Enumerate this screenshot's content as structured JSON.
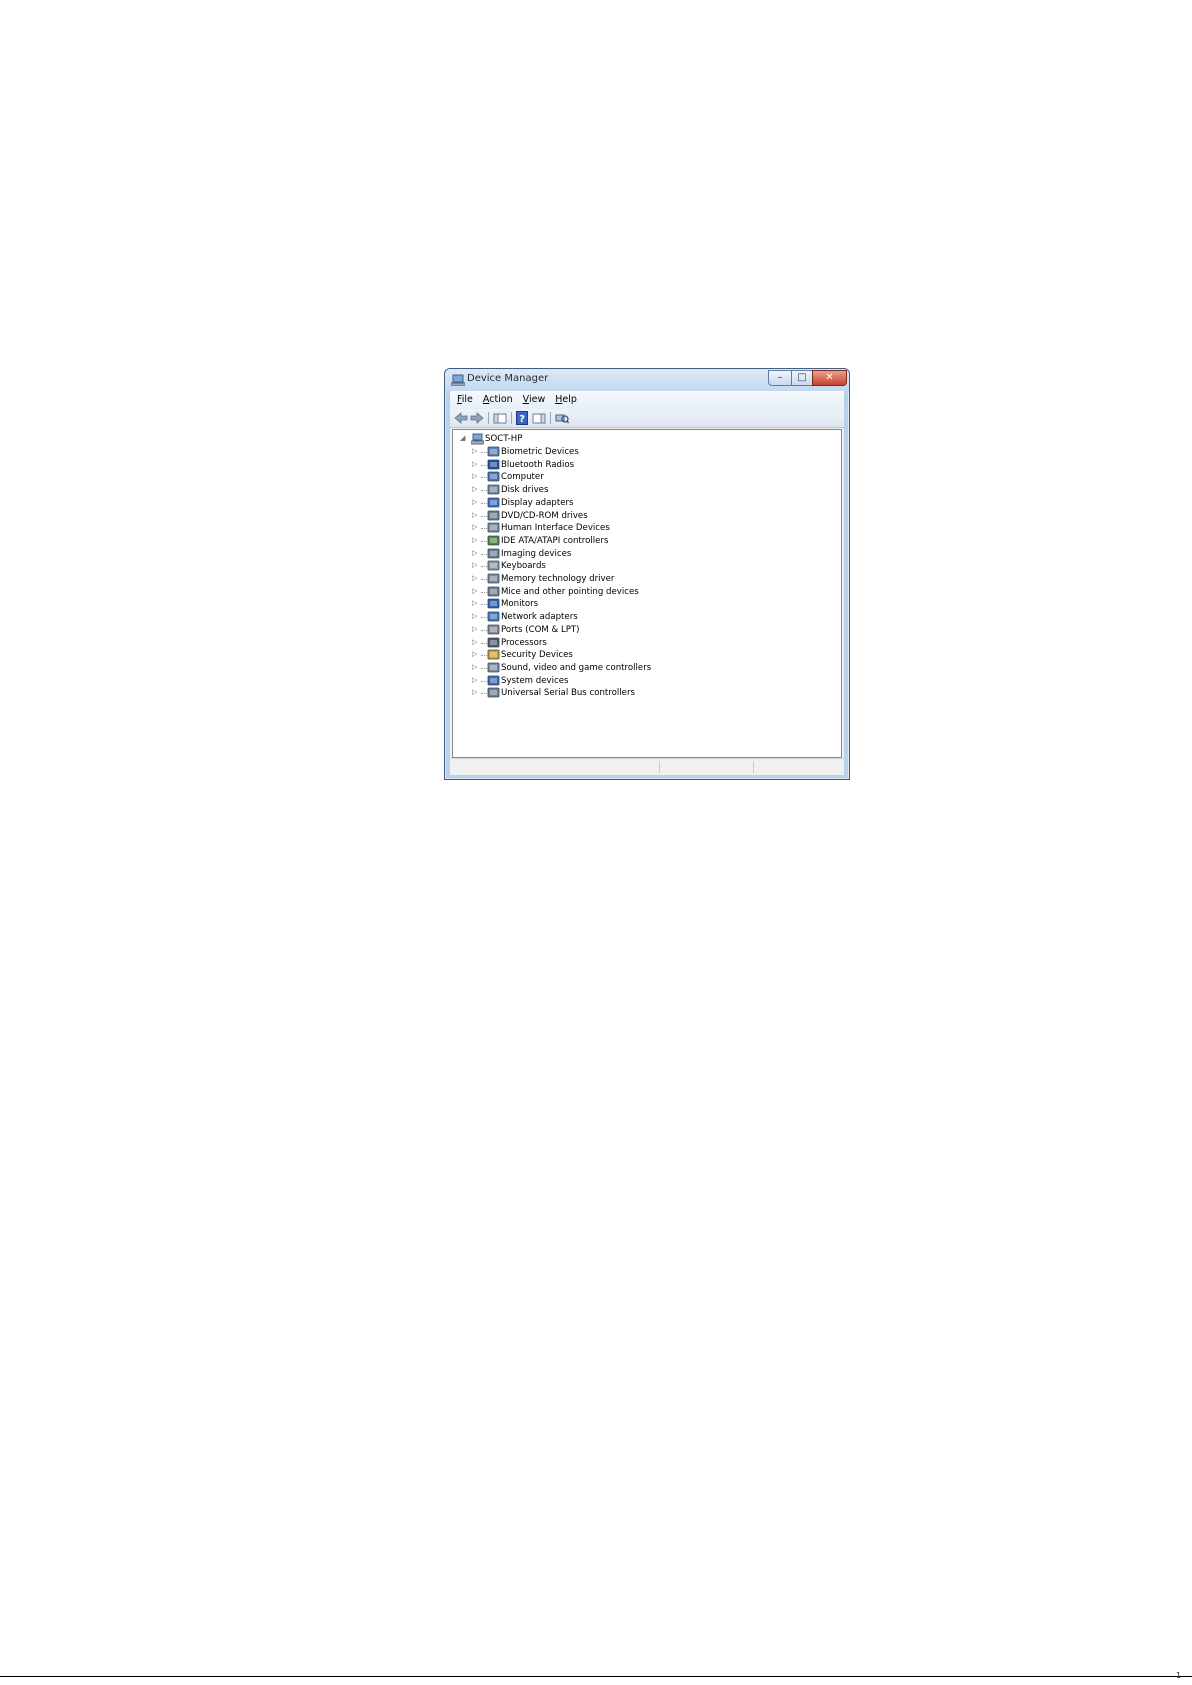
{
  "window": {
    "title": "Device Manager",
    "controls": {
      "minimize": "–",
      "maximize": "□",
      "close": "✕"
    }
  },
  "menu": [
    {
      "key": "F",
      "rest": "ile"
    },
    {
      "key": "A",
      "rest": "ction"
    },
    {
      "key": "V",
      "rest": "iew"
    },
    {
      "key": "H",
      "rest": "elp"
    }
  ],
  "toolbar": {
    "icons": [
      "back-arrow-icon",
      "forward-arrow-icon",
      "show-hide-console-tree-icon",
      "help-icon",
      "properties-pane-icon",
      "scan-hardware-changes-icon"
    ]
  },
  "tree": {
    "root": {
      "label": "SOCT-HP",
      "expander": "◢",
      "icon": "computer-icon"
    },
    "children": [
      {
        "label": "Biometric Devices",
        "icon": "biometric-icon"
      },
      {
        "label": "Bluetooth Radios",
        "icon": "bluetooth-icon"
      },
      {
        "label": "Computer",
        "icon": "computer-icon"
      },
      {
        "label": "Disk drives",
        "icon": "disk-drive-icon"
      },
      {
        "label": "Display adapters",
        "icon": "display-adapter-icon"
      },
      {
        "label": "DVD/CD-ROM drives",
        "icon": "dvd-drive-icon"
      },
      {
        "label": "Human Interface Devices",
        "icon": "hid-icon"
      },
      {
        "label": "IDE ATA/ATAPI controllers",
        "icon": "ide-controller-icon"
      },
      {
        "label": "Imaging devices",
        "icon": "imaging-device-icon"
      },
      {
        "label": "Keyboards",
        "icon": "keyboard-icon"
      },
      {
        "label": "Memory technology driver",
        "icon": "memory-driver-icon"
      },
      {
        "label": "Mice and other pointing devices",
        "icon": "mouse-icon"
      },
      {
        "label": "Monitors",
        "icon": "monitor-icon"
      },
      {
        "label": "Network adapters",
        "icon": "network-adapter-icon"
      },
      {
        "label": "Ports (COM & LPT)",
        "icon": "port-icon"
      },
      {
        "label": "Processors",
        "icon": "processor-icon"
      },
      {
        "label": "Security Devices",
        "icon": "security-device-icon"
      },
      {
        "label": "Sound, video and game controllers",
        "icon": "sound-icon"
      },
      {
        "label": "System devices",
        "icon": "system-device-icon"
      },
      {
        "label": "Universal Serial Bus controllers",
        "icon": "usb-icon"
      }
    ],
    "collapsed_expander": "▷"
  },
  "page": {
    "marker": "1"
  }
}
